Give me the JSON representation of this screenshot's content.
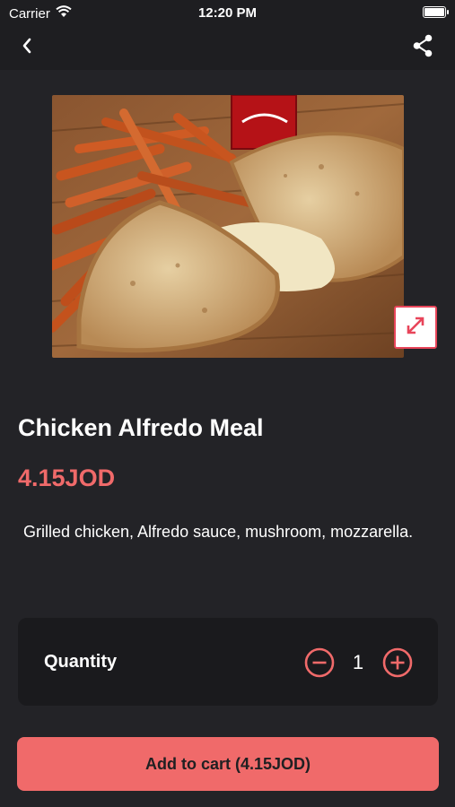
{
  "status_bar": {
    "carrier": "Carrier",
    "time": "12:20 PM",
    "wifi_icon": "wifi-icon",
    "battery_icon": "battery-icon"
  },
  "nav": {
    "back_icon": "chevron-left-icon",
    "share_icon": "share-icon"
  },
  "product": {
    "image_subject": "calzone-with-fries-and-soda",
    "expand_icon": "expand-arrows-icon",
    "title": "Chicken Alfredo Meal",
    "price": "4.15JOD",
    "description": "Grilled chicken, Alfredo sauce, mushroom, mozzarella."
  },
  "quantity": {
    "label": "Quantity",
    "value": "1",
    "minus_icon": "minus-circle-icon",
    "plus_icon": "plus-circle-icon"
  },
  "cart": {
    "button_label": "Add to cart (4.15JOD)"
  },
  "colors": {
    "background": "#232327",
    "bar": "#1e1e21",
    "card": "#1a1a1d",
    "accent": "#f06a6a",
    "expand_border": "#e8455a"
  }
}
